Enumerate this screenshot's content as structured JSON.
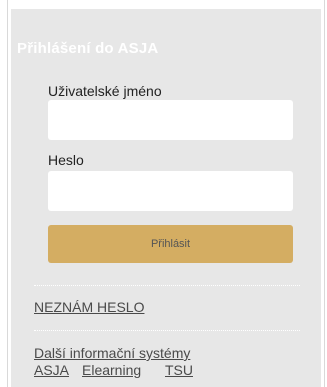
{
  "login": {
    "title": "Přihlášení do ASJA",
    "username_label": "Uživatelské jméno",
    "username_value": "",
    "password_label": "Heslo",
    "password_value": "",
    "submit_label": "Přihlásit"
  },
  "links": {
    "forgot_password": "NEZNÁM HESLO",
    "other_systems": "Další informační systémy",
    "asja": "ASJA",
    "elearning": "Elearning",
    "tsu": "TSU"
  },
  "colors": {
    "panel_bg": "#e7e7e7",
    "button_bg": "#d4ad62",
    "title_text": "#ffffff"
  }
}
